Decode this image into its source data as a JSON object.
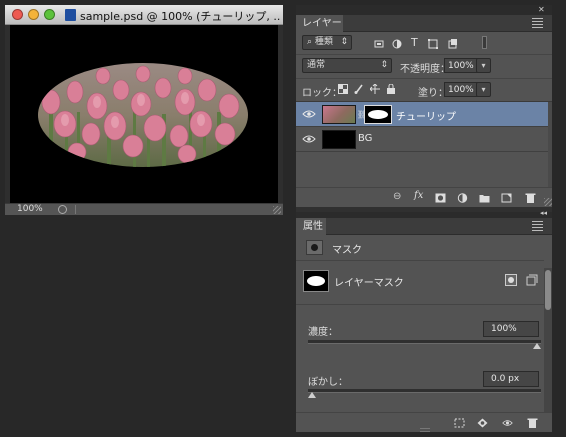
{
  "document": {
    "title": "sample.psd @ 100% (チューリップ, ...",
    "zoom": "100%"
  },
  "layers_panel": {
    "tab_label": "レイヤー",
    "filter_label": "種類",
    "blend_mode": "通常",
    "opacity_label": "不透明度：",
    "opacity_value": "100%",
    "lock_label": "ロック：",
    "fill_label": "塗り：",
    "fill_value": "100%",
    "layers": [
      {
        "name": "チューリップ",
        "selected": true,
        "visible": true,
        "has_mask": true
      },
      {
        "name": "BG",
        "selected": false,
        "visible": true,
        "has_mask": false
      }
    ]
  },
  "properties_panel": {
    "tab_label": "属性",
    "section_title": "マスク",
    "mask_label": "レイヤーマスク",
    "density_label": "濃度：",
    "density_value": "100%",
    "density_level": 1.0,
    "feather_label": "ぼかし：",
    "feather_value": "0.0 px",
    "feather_level": 0.0
  },
  "colors": {
    "app_background": "#282828",
    "panel_background": "#535353",
    "selection": "#6b83a6",
    "tulip_pink": "#c86f87"
  }
}
